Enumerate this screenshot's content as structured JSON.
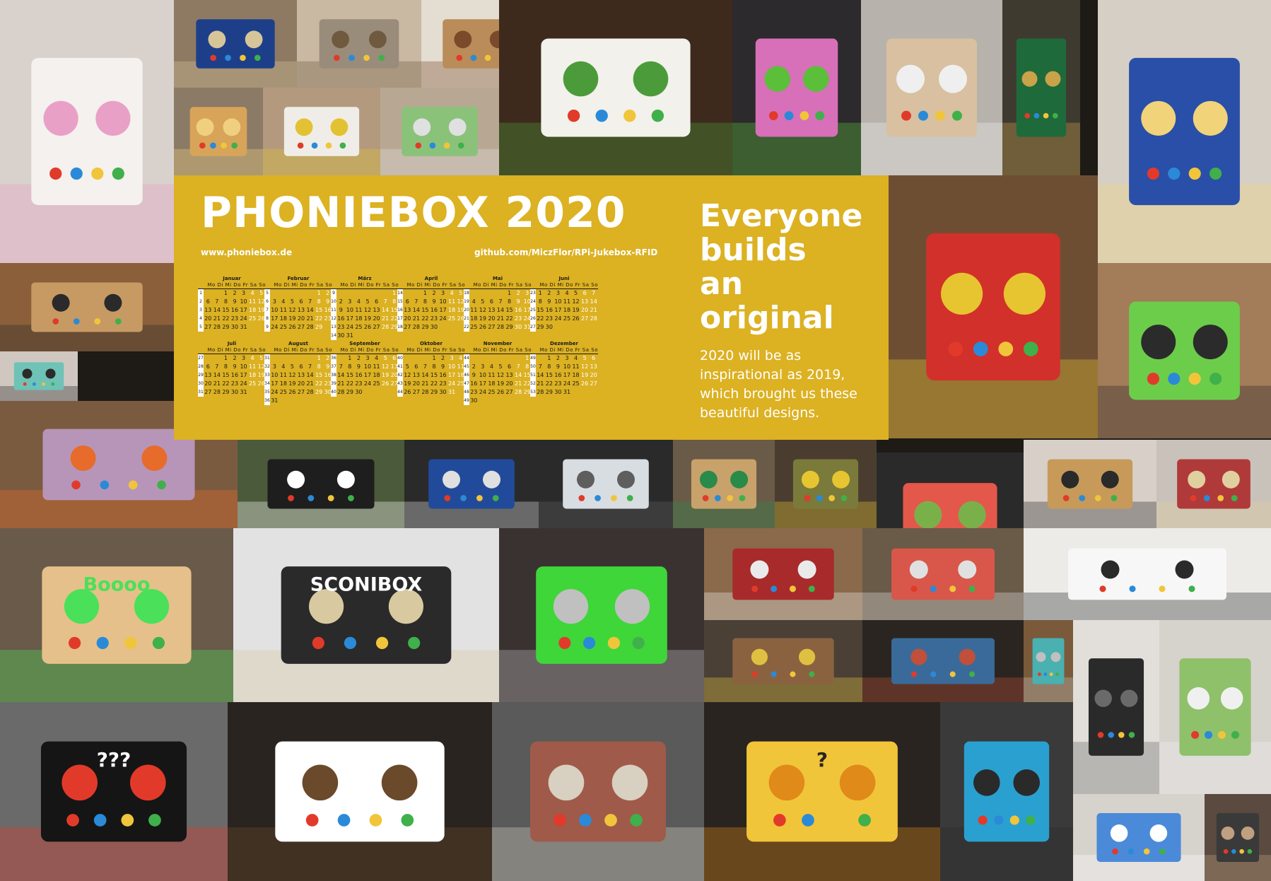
{
  "poster": {
    "title": "PHONIEBOX 2020",
    "website": "www.phoniebox.de",
    "github": "github.com/MiczFlor/RPi-Jukebox-RFID",
    "tagline": [
      "Everyone",
      "builds",
      "an",
      "original"
    ],
    "description": "2020 will be as inspirational as 2019, which brought us these beautiful designs.",
    "colors": {
      "panel": "#dcb122",
      "text": "#ffffff"
    }
  },
  "calendar": {
    "weekday_headers": [
      "Mo",
      "Di",
      "Mi",
      "Do",
      "Fr",
      "Sa",
      "So"
    ],
    "months": [
      {
        "name": "Januar",
        "offset": 2,
        "days": 31,
        "first_week": 1
      },
      {
        "name": "Februar",
        "offset": 5,
        "days": 29,
        "first_week": 5
      },
      {
        "name": "März",
        "offset": 6,
        "days": 31,
        "first_week": 9
      },
      {
        "name": "April",
        "offset": 2,
        "days": 30,
        "first_week": 14
      },
      {
        "name": "Mai",
        "offset": 4,
        "days": 31,
        "first_week": 18
      },
      {
        "name": "Juni",
        "offset": 0,
        "days": 30,
        "first_week": 23
      },
      {
        "name": "Juli",
        "offset": 2,
        "days": 31,
        "first_week": 27
      },
      {
        "name": "August",
        "offset": 5,
        "days": 31,
        "first_week": 31
      },
      {
        "name": "September",
        "offset": 1,
        "days": 30,
        "first_week": 36
      },
      {
        "name": "Oktober",
        "offset": 3,
        "days": 31,
        "first_week": 40
      },
      {
        "name": "November",
        "offset": 6,
        "days": 30,
        "first_week": 44
      },
      {
        "name": "Dezember",
        "offset": 1,
        "days": 31,
        "first_week": 49
      }
    ]
  },
  "photos": [
    {
      "name": "unicorn-box-photo",
      "bg": "#d9d2cc",
      "fg": "#f4f1ee",
      "accent": "#e9a0c6",
      "label": ""
    },
    {
      "name": "blue-box-photo",
      "bg": "#8e7a63",
      "fg": "#1d3f8a",
      "accent": "#d7c59a",
      "label": ""
    },
    {
      "name": "grill-speaker-photo",
      "bg": "#c9b8a2",
      "fg": "#9a8c7a",
      "accent": "#6f5a3f",
      "label": ""
    },
    {
      "name": "wood-box-handle-photo",
      "bg": "#e4ddd2",
      "fg": "#b98c59",
      "accent": "#7a4a2a",
      "label": ""
    },
    {
      "name": "lego-box-photo",
      "bg": "#3d2a1d",
      "fg": "#f2f1ec",
      "accent": "#4c9b3a",
      "label": ""
    },
    {
      "name": "puppet-box-photo",
      "bg": "#2c2a2d",
      "fg": "#d86fb9",
      "accent": "#5bbf3a",
      "label": ""
    },
    {
      "name": "plywood-speaker-photo",
      "bg": "#b8b2ac",
      "fg": "#d8c0a0",
      "accent": "#efefef",
      "label": ""
    },
    {
      "name": "wiring-board-photo",
      "bg": "#3f3a30",
      "fg": "#1f6a3a",
      "accent": "#c9a24a",
      "label": ""
    },
    {
      "name": "princess-box-photo",
      "bg": "#d6cfc6",
      "fg": "#2a4fa8",
      "accent": "#f1d37a",
      "label": ""
    },
    {
      "name": "lantern-box-photo",
      "bg": "#8a7a66",
      "fg": "#d7a45a",
      "accent": "#f0d080",
      "label": ""
    },
    {
      "name": "minion-box-photo",
      "bg": "#b39a7e",
      "fg": "#f0ede8",
      "accent": "#e2c232",
      "label": ""
    },
    {
      "name": "green-radio-photo",
      "bg": "#b8a893",
      "fg": "#8ac27a",
      "accent": "#e0e0e0",
      "label": ""
    },
    {
      "name": "boombox-photo",
      "bg": "#8a5f3a",
      "fg": "#c79a64",
      "accent": "#2a2a2a",
      "label": ""
    },
    {
      "name": "teal-radio-photo",
      "bg": "#cfc7c0",
      "fg": "#6fc2b6",
      "accent": "#2b2b2b",
      "label": ""
    },
    {
      "name": "lego-tower-photo",
      "bg": "#6e4e33",
      "fg": "#d2302a",
      "accent": "#e6c530",
      "label": ""
    },
    {
      "name": "lottas-box-photo",
      "bg": "#a37c59",
      "fg": "#6ccd4a",
      "accent": "#2b2b2b",
      "label": ""
    },
    {
      "name": "purple-box-photo",
      "bg": "#7a5b3f",
      "fg": "#b795b8",
      "accent": "#e76b2a",
      "label": ""
    },
    {
      "name": "handprint-box-photo",
      "bg": "#4a5a3a",
      "fg": "#1e1e1e",
      "accent": "#ffffff",
      "label": ""
    },
    {
      "name": "rfid-tags-photo",
      "bg": "#2a2a2a",
      "fg": "#214b9a",
      "accent": "#e0e0e0",
      "label": ""
    },
    {
      "name": "touchscreen-photo",
      "bg": "#2a2a2a",
      "fg": "#d8dde2",
      "accent": "#5e5e5e",
      "label": ""
    },
    {
      "name": "bamboo-box-photo",
      "bg": "#6a5a48",
      "fg": "#c8a26a",
      "accent": "#2a8a4a",
      "label": ""
    },
    {
      "name": "olive-box-photo",
      "bg": "#4a3d30",
      "fg": "#7a7a3a",
      "accent": "#e6c530",
      "label": ""
    },
    {
      "name": "frog-box-photo",
      "bg": "#2a2a2a",
      "fg": "#e3584a",
      "accent": "#7ab04a",
      "label": ""
    },
    {
      "name": "oak-speaker-photo",
      "bg": "#d8d0c8",
      "fg": "#c79a5a",
      "accent": "#2a2a2a",
      "label": ""
    },
    {
      "name": "red-box-photo",
      "bg": "#c9c2ba",
      "fg": "#b03a3a",
      "accent": "#e0d0a0",
      "label": ""
    },
    {
      "name": "dot-matrix-box-photo",
      "bg": "#6a5a4a",
      "fg": "#e6c08a",
      "accent": "#4be05a",
      "label": "Boooo"
    },
    {
      "name": "sconibox-photo",
      "bg": "#e2e2e2",
      "fg": "#2a2a2a",
      "accent": "#d8c9a0",
      "label": "SCONIBOX"
    },
    {
      "name": "green-pyramid-box-photo",
      "bg": "#3a3230",
      "fg": "#3fd63a",
      "accent": "#c0c0c0",
      "label": ""
    },
    {
      "name": "red-speaker-box-photo",
      "bg": "#8a6a4a",
      "fg": "#a82a2a",
      "accent": "#eaeaea",
      "label": ""
    },
    {
      "name": "quilted-box-photo",
      "bg": "#6a5a48",
      "fg": "#d8574a",
      "accent": "#e0e0e0",
      "label": ""
    },
    {
      "name": "three-boxes-photo",
      "bg": "#ecebe8",
      "fg": "#f7f7f7",
      "accent": "#2a2a2a",
      "label": ""
    },
    {
      "name": "wooden-radio-photo",
      "bg": "#4a4036",
      "fg": "#8a6240",
      "accent": "#e0c040",
      "label": ""
    },
    {
      "name": "cable-inside-photo",
      "bg": "#2a2520",
      "fg": "#3a6a9a",
      "accent": "#c0503a",
      "label": ""
    },
    {
      "name": "turquoise-box-photo",
      "bg": "#7a5a3a",
      "fg": "#4ab0b0",
      "accent": "#c0c0c0",
      "label": ""
    },
    {
      "name": "parts-layout-photo",
      "bg": "#e2dfda",
      "fg": "#2a2a2a",
      "accent": "#6a6a6a",
      "label": ""
    },
    {
      "name": "camper-van-photo",
      "bg": "#d6d2cc",
      "fg": "#8fc06a",
      "accent": "#f0f0f0",
      "label": ""
    },
    {
      "name": "spider-box-photo",
      "bg": "#6a6a6a",
      "fg": "#151515",
      "accent": "#e23a2a",
      "label": "???"
    },
    {
      "name": "owl-box-photo",
      "bg": "#2a2420",
      "fg": "#ffffff",
      "accent": "#6a4a2a",
      "label": ""
    },
    {
      "name": "vintage-tin-photo",
      "bg": "#5a5a5a",
      "fg": "#a05a4a",
      "accent": "#d8d0c0",
      "label": ""
    },
    {
      "name": "question-block-photo",
      "bg": "#2a2420",
      "fg": "#f1c53a",
      "accent": "#e08a1a",
      "label": "?"
    },
    {
      "name": "cube-gnome-photo",
      "bg": "#3a3a3a",
      "fg": "#2aa0d0",
      "accent": "#2a2a2a",
      "label": ""
    },
    {
      "name": "blue-cube-photo",
      "bg": "#d6d2cc",
      "fg": "#4a8ad8",
      "accent": "#ffffff",
      "label": ""
    },
    {
      "name": "electronics-photo",
      "bg": "#5a4a40",
      "fg": "#3a3a3a",
      "accent": "#c0a080",
      "label": ""
    }
  ]
}
